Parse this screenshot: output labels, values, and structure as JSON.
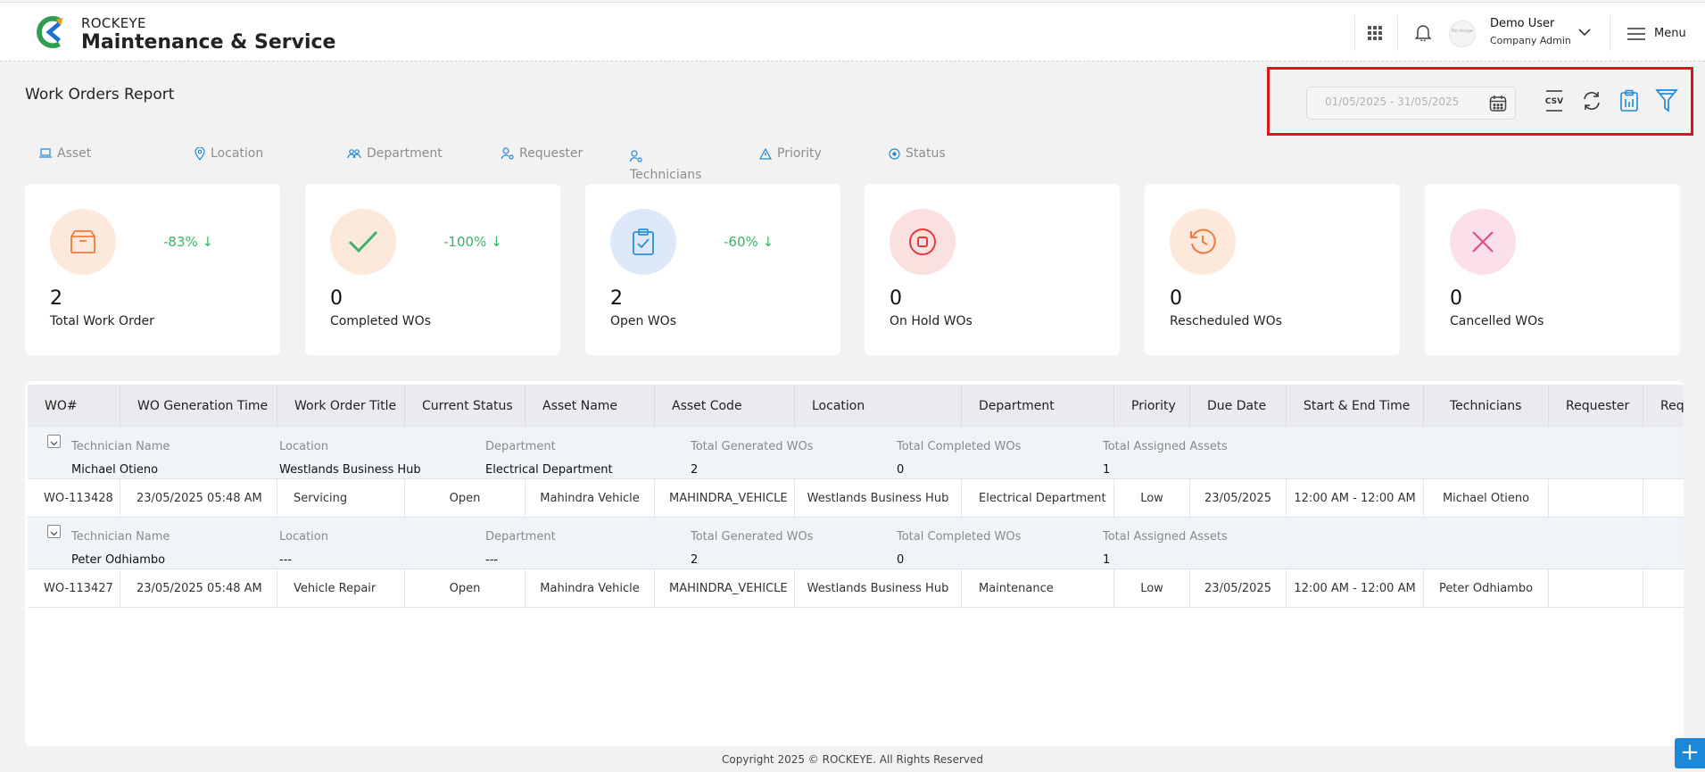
{
  "brand": {
    "top": "ROCKEYE",
    "main": "Maintenance & Service"
  },
  "user": {
    "name": "Demo User",
    "role": "Company Admin",
    "avatar_text": "No image"
  },
  "menu_label": "Menu",
  "page_title": "Work Orders Report",
  "date_range": "01/05/2025 - 31/05/2025",
  "toolbar_icons": [
    "calendar-icon",
    "csv-icon",
    "refresh-icon",
    "clipboard-icon",
    "filter-icon"
  ],
  "filters": [
    "Asset",
    "Location",
    "Department",
    "Requester",
    "Technicians",
    "Priority",
    "Status"
  ],
  "cards": [
    {
      "value": "2",
      "label": "Total Work Order",
      "delta": "-83% ↓",
      "icon": "box-icon",
      "color": "#f07a3c",
      "bg": "#fde8dc"
    },
    {
      "value": "0",
      "label": "Completed WOs",
      "delta": "-100% ↓",
      "icon": "check-icon",
      "color": "#3bb26a",
      "bg": "#fde8dc"
    },
    {
      "value": "2",
      "label": "Open WOs",
      "delta": "-60% ↓",
      "icon": "clipboard-check-icon",
      "color": "#2b8fd9",
      "bg": "#dde9f8"
    },
    {
      "value": "0",
      "label": "On Hold WOs",
      "delta": "",
      "icon": "stop-icon",
      "color": "#e23b3b",
      "bg": "#fbe0e0"
    },
    {
      "value": "0",
      "label": "Rescheduled WOs",
      "delta": "",
      "icon": "history-icon",
      "color": "#f07a3c",
      "bg": "#fde8dc"
    },
    {
      "value": "0",
      "label": "Cancelled WOs",
      "delta": "",
      "icon": "x-icon",
      "color": "#e64a8b",
      "bg": "#fbe0ec"
    }
  ],
  "table": {
    "columns": [
      "WO#",
      "WO Generation Time",
      "Work Order Title",
      "Current Status",
      "Asset Name",
      "Asset Code",
      "Location",
      "Department",
      "Priority",
      "Due Date",
      "Start & End Time",
      "Technicians",
      "Requester",
      "Req"
    ],
    "group_labels": [
      "Technician Name",
      "Location",
      "Department",
      "Total Generated WOs",
      "Total Completed WOs",
      "Total Assigned Assets"
    ],
    "groups": [
      {
        "values": [
          "Michael Otieno",
          "Westlands Business Hub",
          "Electrical Department",
          "2",
          "0",
          "1"
        ],
        "row": [
          "WO-113428",
          "23/05/2025 05:48 AM",
          "Servicing",
          "Open",
          "Mahindra Vehicle",
          "MAHINDRA_VEHICLE",
          "Westlands Business Hub",
          "Electrical Department",
          "Low",
          "23/05/2025",
          "12:00 AM - 12:00 AM",
          "Michael Otieno",
          "",
          ""
        ]
      },
      {
        "values": [
          "Peter Odhiambo",
          "---",
          "---",
          "2",
          "0",
          "1"
        ],
        "row": [
          "WO-113427",
          "23/05/2025 05:48 AM",
          "Vehicle Repair",
          "Open",
          "Mahindra Vehicle",
          "MAHINDRA_VEHICLE",
          "Westlands Business Hub",
          "Maintenance",
          "Low",
          "23/05/2025",
          "12:00 AM - 12:00 AM",
          "Peter Odhiambo",
          "",
          ""
        ]
      }
    ]
  },
  "footer": "Copyright 2025 © ROCKEYE. All Rights Reserved",
  "fab_label": "+"
}
